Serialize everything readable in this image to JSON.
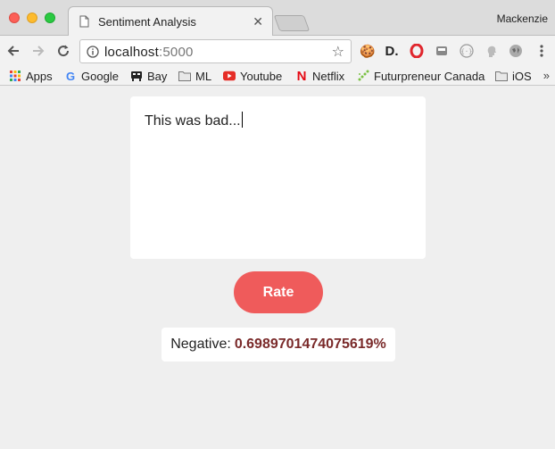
{
  "browser": {
    "tab": {
      "title": "Sentiment Analysis"
    },
    "profile_name": "Mackenzie",
    "address": {
      "host": "localhost",
      "port": ":5000"
    },
    "bookmarks": [
      {
        "label": "Apps",
        "icon": "apps-grid-icon"
      },
      {
        "label": "Google",
        "icon": "google-icon"
      },
      {
        "label": "Bay",
        "icon": "bay-icon"
      },
      {
        "label": "ML",
        "icon": "folder-icon"
      },
      {
        "label": "Youtube",
        "icon": "youtube-icon"
      },
      {
        "label": "Netflix",
        "icon": "netflix-icon"
      },
      {
        "label": "Futurpreneur Canada",
        "icon": "futurpreneur-icon"
      },
      {
        "label": "iOS",
        "icon": "folder-icon"
      }
    ],
    "overflow": "»"
  },
  "page": {
    "input_text": "This was bad...",
    "rate_label": "Rate",
    "result": {
      "label": "Negative:",
      "score": "0.6989701474075619%"
    }
  },
  "colors": {
    "rate_button": "#ef5b5b",
    "score_text": "#7a2a2a",
    "page_bg": "#efefef"
  }
}
